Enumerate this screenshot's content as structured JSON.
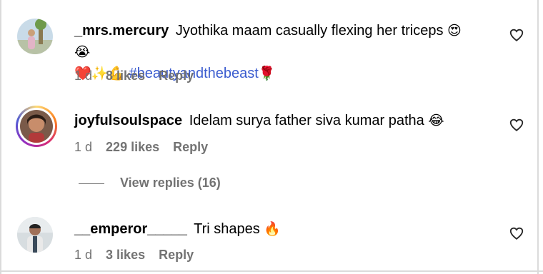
{
  "comments": [
    {
      "username": "_mrs.mercury",
      "text_line1": "Jyothika maam casually flexing her triceps",
      "emoji_line1": "😍😭",
      "emoji_line2": "❤️✨💪",
      "hashtag": "#beautyandthebeast",
      "emoji_after_hashtag": "🌹",
      "time": "1 d",
      "likes": "8 likes",
      "reply": "Reply"
    },
    {
      "username": "joyfulsoulspace",
      "text": "Idelam surya father siva kumar patha",
      "emoji": "😂",
      "time": "1 d",
      "likes": "229 likes",
      "reply": "Reply"
    },
    {
      "username": "__emperor_____",
      "text": "Tri shapes",
      "emoji": "🔥",
      "time": "1 d",
      "likes": "3 likes",
      "reply": "Reply"
    }
  ],
  "view_replies": "View replies (16)",
  "colors": {
    "muted": "#737373",
    "hashtag": "#3b5ccf",
    "divider": "#dbdbdb"
  },
  "icons": {
    "like": "heart-outline-icon"
  }
}
